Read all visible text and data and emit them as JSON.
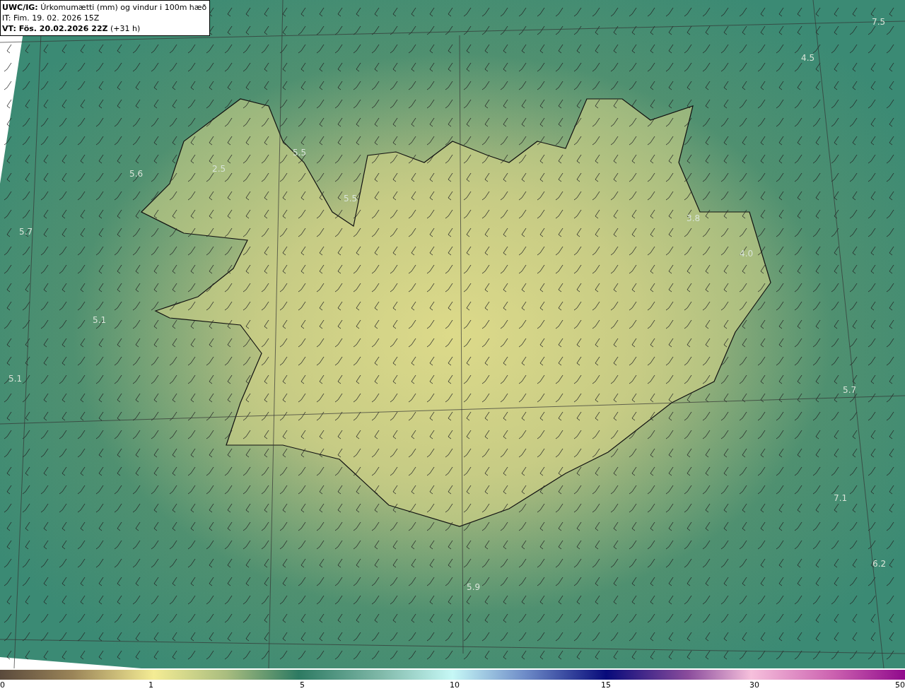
{
  "header": {
    "lines": [
      "**UWC/IG:** Úrkomumætti (mm) og vindur i 100m hæð",
      "IT: Fim. 19. 02. 2026 15Z",
      "**VT: Fös. 20.02.2026 22Z** (+31 h)"
    ]
  },
  "map": {
    "value_labels": [
      "7.5",
      "4.5",
      "5.5",
      "5.6",
      "2.5",
      "5.5",
      "5.7",
      "3.8",
      "4.0",
      "5.1",
      "5.1",
      "5.7",
      "7.1",
      "6.2",
      "5.9"
    ]
  },
  "colorbar": {
    "ticks": [
      "0",
      "1",
      "5",
      "10",
      "15",
      "30",
      "50"
    ]
  }
}
